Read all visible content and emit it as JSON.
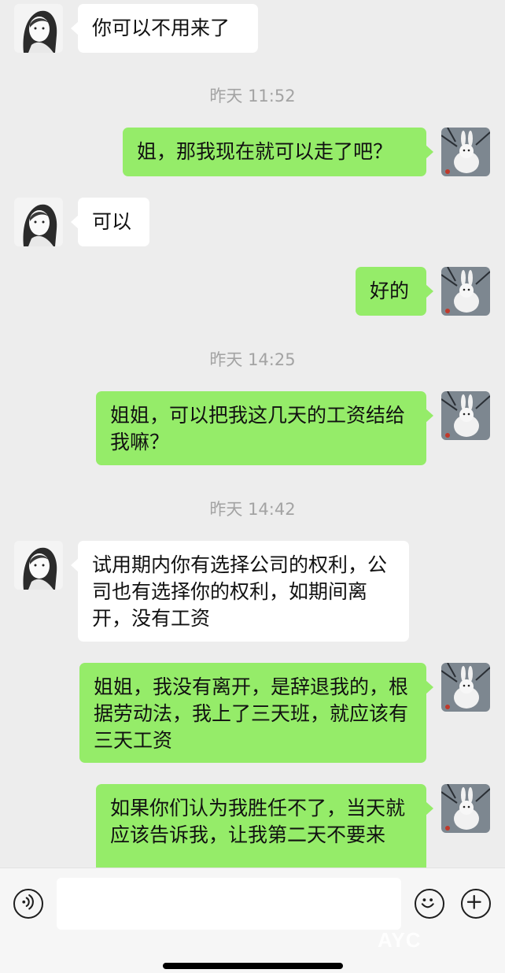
{
  "messages": [
    {
      "text": "你可以不用来了"
    },
    {
      "text": "姐，那我现在就可以走了吧？"
    },
    {
      "text": "可以"
    },
    {
      "text": "好的"
    },
    {
      "text": "姐姐，可以把我这几天的工资结给我嘛？"
    },
    {
      "text": "试用期内你有选择公司的权利，公司也有选择你的权利，如期间离开，没有工资"
    },
    {
      "text": "姐姐，我没有离开，是辞退我的，根据劳动法，我上了三天班，就应该有三天工资"
    },
    {
      "text": "如果你们认为我胜任不了，当天就应该告诉我，让我第二天不要来"
    }
  ],
  "timestamps": [
    "昨天 11:52",
    "昨天 14:25",
    "昨天 14:42"
  ],
  "input": {
    "placeholder": ""
  },
  "icons": {
    "voice": "voice-icon",
    "emoji": "emoji-icon",
    "plus": "plus-icon"
  },
  "watermark": "AYC",
  "colors": {
    "background": "#ededed",
    "incoming_bubble": "#ffffff",
    "outgoing_bubble": "#95ec69",
    "timestamp": "#a3a3a3"
  }
}
